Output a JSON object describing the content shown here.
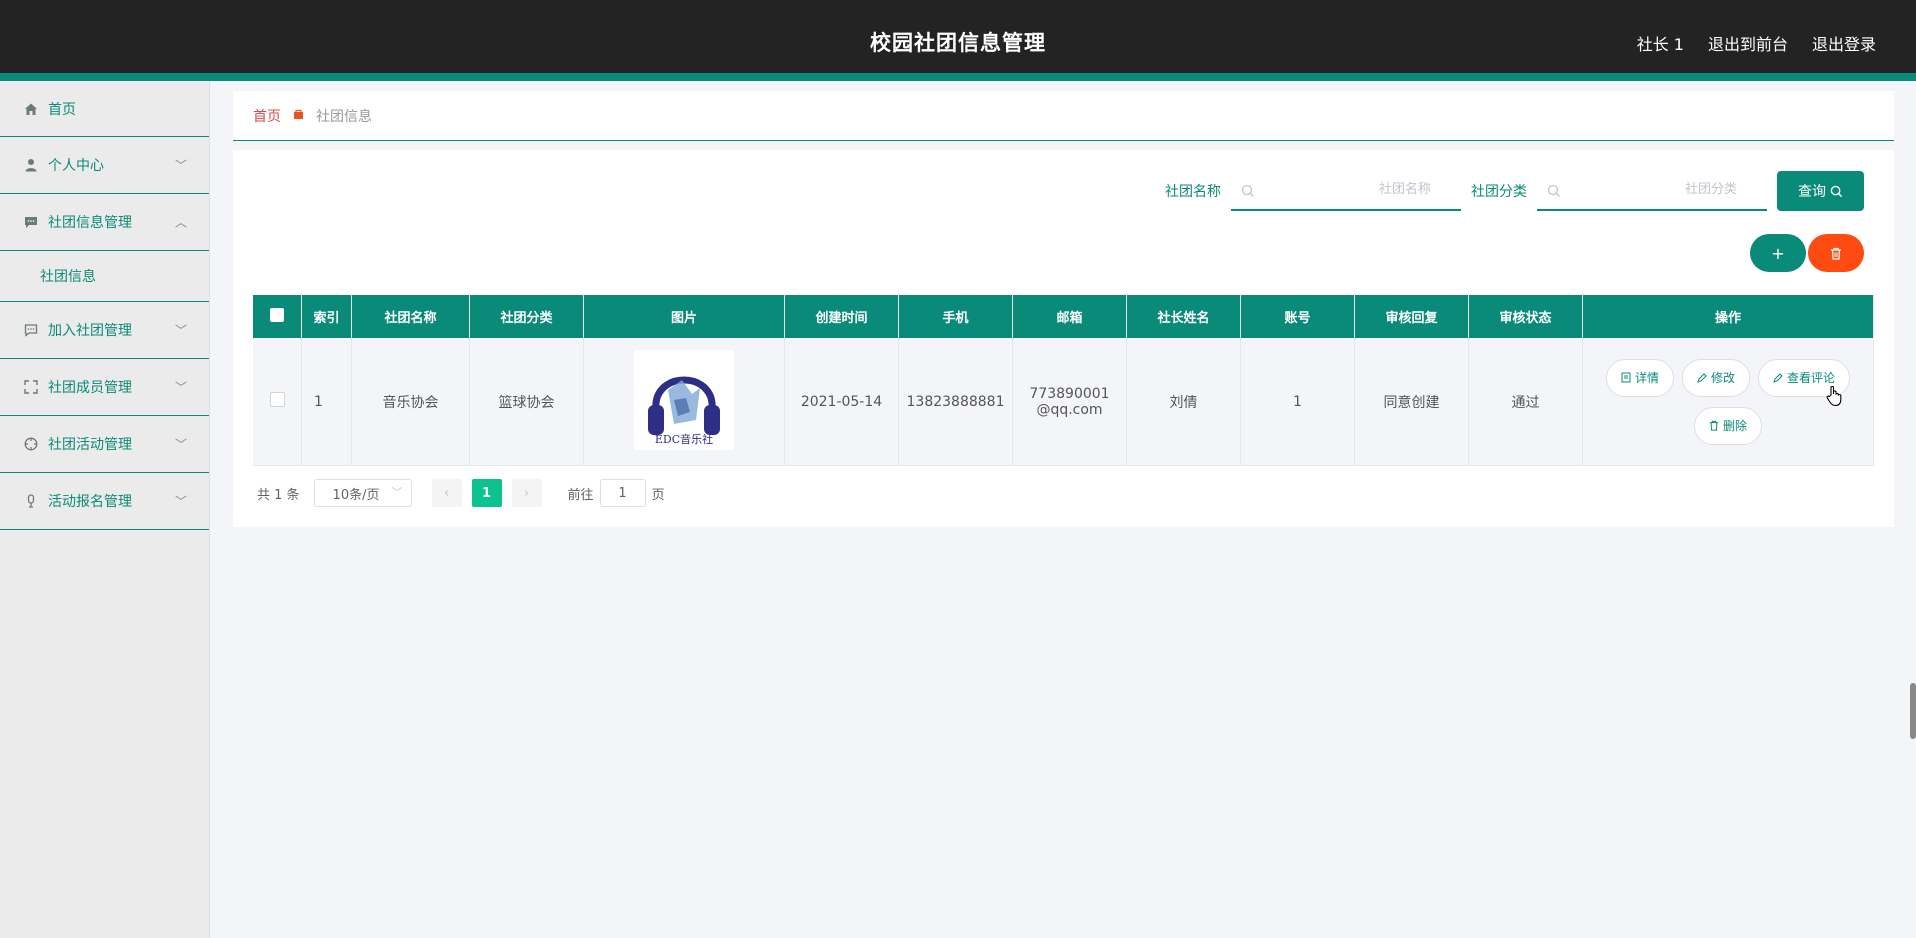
{
  "header": {
    "title": "校园社团信息管理",
    "user": "社长 1",
    "to_front": "退出到前台",
    "logout": "退出登录"
  },
  "sidebar": {
    "items": [
      {
        "label": "首页",
        "icon": "home-icon"
      },
      {
        "label": "个人中心",
        "icon": "user-icon"
      },
      {
        "label": "社团信息管理",
        "icon": "message-icon",
        "expanded": true,
        "children": [
          "社团信息"
        ]
      },
      {
        "label": "加入社团管理",
        "icon": "chat-icon"
      },
      {
        "label": "社团成员管理",
        "icon": "fullscreen-icon"
      },
      {
        "label": "社团活动管理",
        "icon": "compass-icon"
      },
      {
        "label": "活动报名管理",
        "icon": "mic-icon"
      }
    ]
  },
  "breadcrumb": {
    "home": "首页",
    "current": "社团信息"
  },
  "search": {
    "name_label": "社团名称",
    "name_placeholder": "社团名称",
    "category_label": "社团分类",
    "category_placeholder": "社团分类",
    "query_label": "查询"
  },
  "actions": {
    "add": "+",
    "delete_icon": "trash-icon"
  },
  "table": {
    "headers": [
      "索引",
      "社团名称",
      "社团分类",
      "图片",
      "创建时间",
      "手机",
      "邮箱",
      "社长姓名",
      "账号",
      "审核回复",
      "审核状态",
      "操作"
    ],
    "rows": [
      {
        "index": "1",
        "name": "音乐协会",
        "category": "篮球协会",
        "image_caption": "EDC音乐社",
        "created": "2021-05-14",
        "phone": "13823888881",
        "email": "773890001@qq.com",
        "leader": "刘倩",
        "account": "1",
        "reply": "同意创建",
        "status": "通过",
        "ops": {
          "detail": "详情",
          "edit": "修改",
          "comments": "查看评论",
          "delete": "删除"
        }
      }
    ]
  },
  "pagination": {
    "total": "共 1 条",
    "page_size": "10条/页",
    "current_page": "1",
    "goto_prefix": "前往",
    "goto_value": "1",
    "goto_suffix": "页"
  },
  "colors": {
    "primary": "#0a8a78",
    "danger": "#ff4a12",
    "header_bg": "#232323",
    "page_active": "#0ac38f"
  }
}
